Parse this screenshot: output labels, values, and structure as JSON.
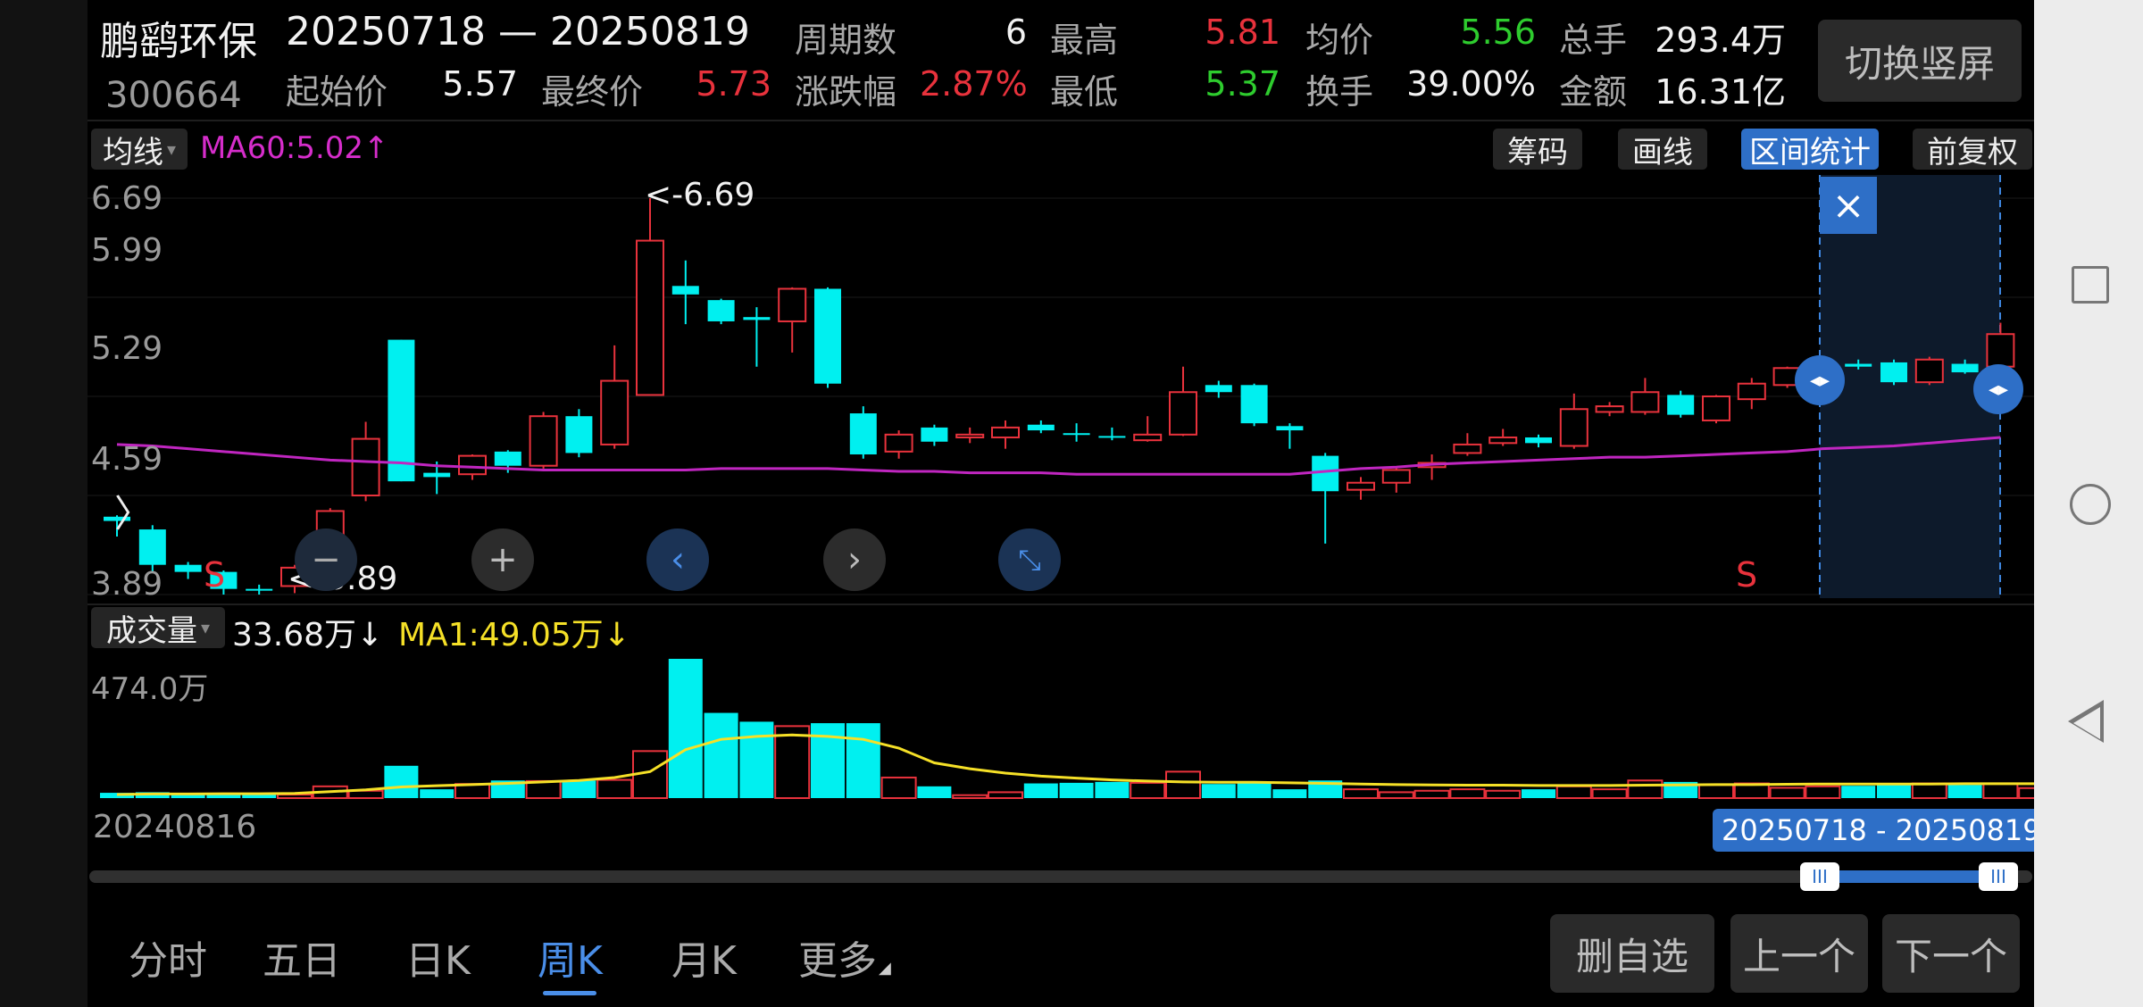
{
  "stock": {
    "name": "鹏鹞环保",
    "code": "300664",
    "range": "20250718 — 20250819"
  },
  "header": {
    "start_label": "起始价",
    "start_value": "5.57",
    "end_label": "最终价",
    "end_value": "5.73",
    "periods_label": "周期数",
    "periods_value": "6",
    "change_label": "涨跌幅",
    "change_value": "2.87%",
    "high_label": "最高",
    "high_value": "5.81",
    "low_label": "最低",
    "low_value": "5.37",
    "avg_label": "均价",
    "avg_value": "5.56",
    "turnover_label": "换手",
    "turnover_value": "39.00%",
    "total_label": "总手",
    "total_value": "293.4万",
    "amount_label": "金额",
    "amount_value": "16.31亿",
    "switch_button": "切换竖屏"
  },
  "toolbar": {
    "ma_select": "均线",
    "ma60": "MA60:5.02",
    "chips": "筹码",
    "draw": "画线",
    "interval_stats": "区间统计",
    "adjust": "前复权"
  },
  "chart": {
    "y_ticks": [
      "6.69",
      "5.99",
      "5.29",
      "4.59",
      "3.89"
    ],
    "max_annotation": "<-6.69",
    "min_annotation": "<-3.89",
    "s_marker": "S",
    "close_symbol": "×"
  },
  "volume": {
    "select": "成交量",
    "value": "33.68万",
    "ma1": "MA1:49.05万",
    "y_max": "474.0万"
  },
  "timeline": {
    "start_date": "20240816",
    "range_label": "20250718 - 20250819"
  },
  "tabs": [
    "分时",
    "五日",
    "日K",
    "周K",
    "月K",
    "更多"
  ],
  "actions": {
    "remove_watch": "删自选",
    "prev": "上一个",
    "next": "下一个"
  },
  "colors": {
    "up": "#e8323c",
    "down": "#00f0f0",
    "ma60": "#c026c0",
    "ma1": "#f5e027",
    "accent": "#2e6fc7"
  },
  "chart_data": {
    "type": "candlestick",
    "title": "",
    "ylim": [
      3.89,
      6.69
    ],
    "y_ticks": [
      6.69,
      5.99,
      5.29,
      4.59,
      3.89
    ],
    "candles": [
      {
        "o": 4.44,
        "c": 4.41,
        "h": 4.45,
        "l": 4.3
      },
      {
        "o": 4.35,
        "c": 4.1,
        "h": 4.38,
        "l": 4.05
      },
      {
        "o": 4.1,
        "c": 4.05,
        "h": 4.12,
        "l": 4.0
      },
      {
        "o": 4.05,
        "c": 3.93,
        "h": 4.06,
        "l": 3.89
      },
      {
        "o": 3.93,
        "c": 3.92,
        "h": 3.96,
        "l": 3.89
      },
      {
        "o": 3.95,
        "c": 4.08,
        "h": 4.1,
        "l": 3.9
      },
      {
        "o": 4.08,
        "c": 4.48,
        "h": 4.5,
        "l": 4.05
      },
      {
        "o": 4.59,
        "c": 4.99,
        "h": 5.11,
        "l": 4.55
      },
      {
        "o": 5.69,
        "c": 4.69,
        "h": 5.69,
        "l": 4.69
      },
      {
        "o": 4.75,
        "c": 4.72,
        "h": 4.83,
        "l": 4.6
      },
      {
        "o": 4.74,
        "c": 4.87,
        "h": 4.88,
        "l": 4.7
      },
      {
        "o": 4.9,
        "c": 4.8,
        "h": 4.91,
        "l": 4.75
      },
      {
        "o": 4.8,
        "c": 5.15,
        "h": 5.18,
        "l": 4.78
      },
      {
        "o": 5.15,
        "c": 4.89,
        "h": 5.2,
        "l": 4.86
      },
      {
        "o": 4.95,
        "c": 5.4,
        "h": 5.65,
        "l": 4.92
      },
      {
        "o": 5.3,
        "c": 6.39,
        "h": 6.69,
        "l": 5.3
      },
      {
        "o": 6.07,
        "c": 6.01,
        "h": 6.25,
        "l": 5.8
      },
      {
        "o": 5.97,
        "c": 5.82,
        "h": 5.98,
        "l": 5.8
      },
      {
        "o": 5.85,
        "c": 5.83,
        "h": 5.92,
        "l": 5.5
      },
      {
        "o": 5.82,
        "c": 6.05,
        "h": 6.06,
        "l": 5.6
      },
      {
        "o": 6.05,
        "c": 5.38,
        "h": 6.06,
        "l": 5.35
      },
      {
        "o": 5.17,
        "c": 4.88,
        "h": 5.22,
        "l": 4.85
      },
      {
        "o": 4.9,
        "c": 5.02,
        "h": 5.05,
        "l": 4.85
      },
      {
        "o": 5.07,
        "c": 4.97,
        "h": 5.09,
        "l": 4.94
      },
      {
        "o": 5.0,
        "c": 5.02,
        "h": 5.07,
        "l": 4.96
      },
      {
        "o": 5.0,
        "c": 5.07,
        "h": 5.12,
        "l": 4.92
      },
      {
        "o": 5.09,
        "c": 5.05,
        "h": 5.12,
        "l": 5.03
      },
      {
        "o": 5.03,
        "c": 5.02,
        "h": 5.1,
        "l": 4.97
      },
      {
        "o": 5.01,
        "c": 5.0,
        "h": 5.07,
        "l": 4.98
      },
      {
        "o": 4.98,
        "c": 5.02,
        "h": 5.15,
        "l": 4.97
      },
      {
        "o": 5.02,
        "c": 5.32,
        "h": 5.5,
        "l": 5.01
      },
      {
        "o": 5.37,
        "c": 5.32,
        "h": 5.4,
        "l": 5.28
      },
      {
        "o": 5.37,
        "c": 5.1,
        "h": 5.38,
        "l": 5.08
      },
      {
        "o": 5.08,
        "c": 5.05,
        "h": 5.1,
        "l": 4.92
      },
      {
        "o": 4.87,
        "c": 4.62,
        "h": 4.89,
        "l": 4.25
      },
      {
        "o": 4.63,
        "c": 4.68,
        "h": 4.72,
        "l": 4.56
      },
      {
        "o": 4.68,
        "c": 4.77,
        "h": 4.79,
        "l": 4.61
      },
      {
        "o": 4.79,
        "c": 4.82,
        "h": 4.88,
        "l": 4.7
      },
      {
        "o": 4.89,
        "c": 4.95,
        "h": 5.03,
        "l": 4.87
      },
      {
        "o": 4.96,
        "c": 5.0,
        "h": 5.06,
        "l": 4.94
      },
      {
        "o": 5.0,
        "c": 4.96,
        "h": 5.02,
        "l": 4.93
      },
      {
        "o": 4.94,
        "c": 5.2,
        "h": 5.31,
        "l": 4.92
      },
      {
        "o": 5.18,
        "c": 5.22,
        "h": 5.25,
        "l": 5.15
      },
      {
        "o": 5.18,
        "c": 5.32,
        "h": 5.42,
        "l": 5.16
      },
      {
        "o": 5.3,
        "c": 5.16,
        "h": 5.33,
        "l": 5.14
      },
      {
        "o": 5.12,
        "c": 5.29,
        "h": 5.3,
        "l": 5.1
      },
      {
        "o": 5.27,
        "c": 5.38,
        "h": 5.42,
        "l": 5.2
      },
      {
        "o": 5.37,
        "c": 5.49,
        "h": 5.5,
        "l": 5.35
      },
      {
        "o": 5.49,
        "c": 5.5,
        "h": 5.55,
        "l": 5.45
      },
      {
        "o": 5.52,
        "c": 5.5,
        "h": 5.55,
        "l": 5.48
      },
      {
        "o": 5.53,
        "c": 5.39,
        "h": 5.55,
        "l": 5.37
      },
      {
        "o": 5.39,
        "c": 5.55,
        "h": 5.57,
        "l": 5.37
      },
      {
        "o": 5.52,
        "c": 5.46,
        "h": 5.55,
        "l": 5.45
      },
      {
        "o": 5.5,
        "c": 5.73,
        "h": 5.81,
        "l": 5.49
      }
    ],
    "ma60": [
      4.95,
      4.94,
      4.92,
      4.9,
      4.88,
      4.86,
      4.84,
      4.83,
      4.82,
      4.8,
      4.79,
      4.78,
      4.77,
      4.77,
      4.77,
      4.77,
      4.77,
      4.78,
      4.78,
      4.78,
      4.78,
      4.77,
      4.76,
      4.76,
      4.75,
      4.75,
      4.75,
      4.74,
      4.74,
      4.74,
      4.74,
      4.74,
      4.74,
      4.74,
      4.76,
      4.78,
      4.79,
      4.81,
      4.82,
      4.83,
      4.84,
      4.85,
      4.86,
      4.86,
      4.87,
      4.88,
      4.89,
      4.9,
      4.92,
      4.93,
      4.94,
      4.96,
      4.98,
      5.0
    ],
    "volume": [
      18,
      20,
      16,
      17,
      14,
      12,
      40,
      25,
      110,
      30,
      48,
      60,
      58,
      60,
      62,
      160,
      474,
      290,
      260,
      245,
      255,
      255,
      70,
      40,
      10,
      20,
      50,
      52,
      55,
      52,
      90,
      48,
      52,
      30,
      60,
      30,
      20,
      25,
      30,
      25,
      30,
      40,
      30,
      60,
      55,
      45,
      50,
      35,
      40,
      42,
      45,
      50,
      45,
      50,
      34
    ],
    "volume_ma": [
      12,
      14,
      14,
      15,
      15,
      16,
      22,
      28,
      38,
      42,
      46,
      50,
      55,
      60,
      70,
      90,
      165,
      200,
      210,
      215,
      210,
      200,
      170,
      120,
      100,
      85,
      75,
      68,
      62,
      58,
      55,
      54,
      54,
      52,
      50,
      48,
      46,
      45,
      44,
      44,
      43,
      43,
      43,
      44,
      45,
      46,
      46,
      47,
      48,
      48,
      48,
      48,
      49,
      49,
      49
    ],
    "volume_max": 474,
    "selected_range": [
      48,
      53
    ]
  }
}
